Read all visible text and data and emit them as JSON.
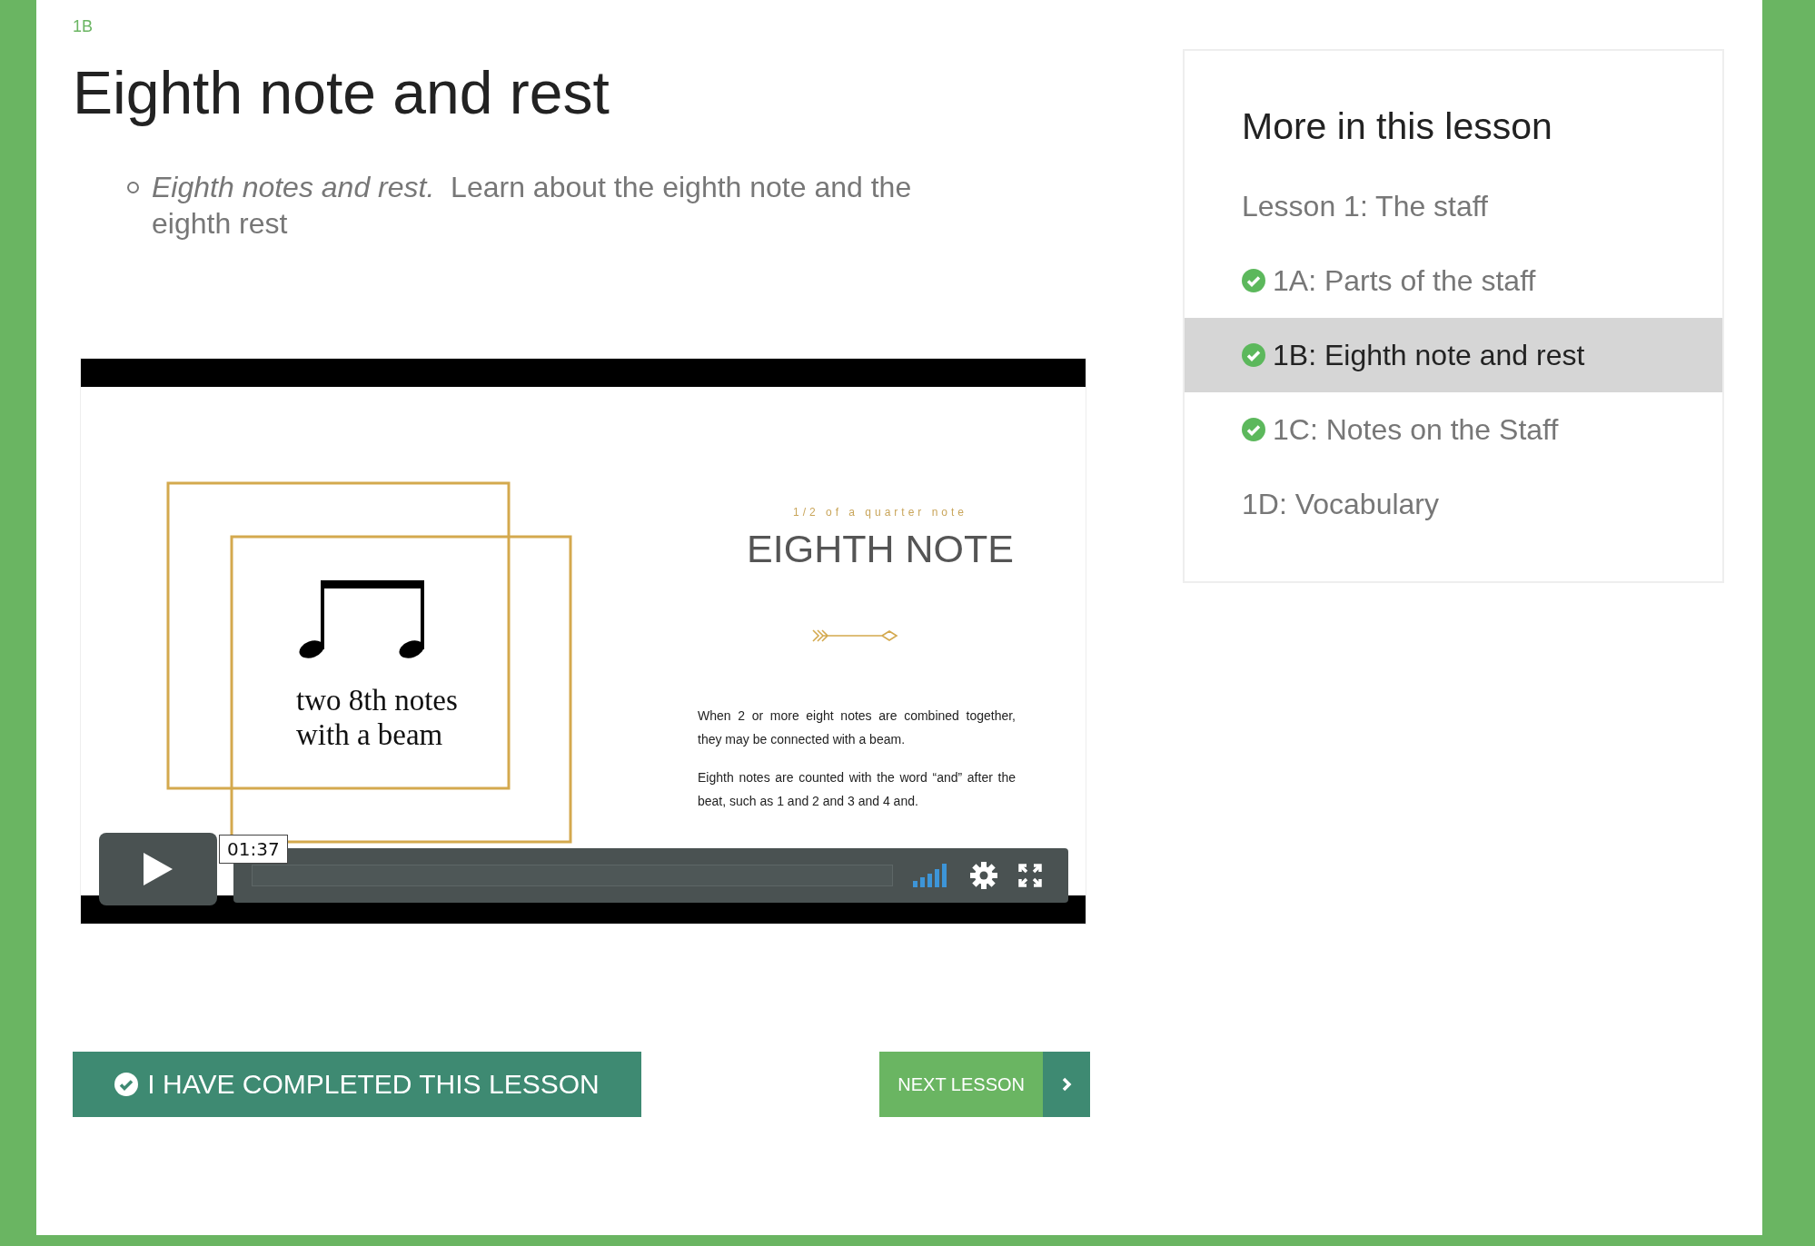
{
  "lesson_code": "1B",
  "title": "Eighth note and rest",
  "bullets": [
    "*Eighth notes and rest.*  Learn about the eighth note and the eighth rest"
  ],
  "video": {
    "slide": {
      "caption": [
        "two 8th notes",
        "with a beam"
      ],
      "subtitle": "1/2 of a quarter note",
      "heading": "EIGHTH NOTE",
      "paragraphs": [
        "When 2 or more eight notes are combined together, they may be connected with a beam.",
        "Eighth notes are counted with the word “and” after the beat, such as 1 and 2 and 3 and 4 and."
      ]
    },
    "time": "01:37"
  },
  "actions": [
    {
      "kind": "complete",
      "label": "I HAVE COMPLETED THIS LESSON"
    },
    {
      "kind": "next",
      "label": "NEXT LESSON"
    }
  ],
  "sidebar": {
    "title": "More in this lesson",
    "items": [
      {
        "label": "Lesson 1: The staff",
        "completed": false,
        "selected": false
      },
      {
        "label": "1A: Parts of the staff",
        "completed": true,
        "selected": false
      },
      {
        "label": "1B: Eighth note and rest",
        "completed": true,
        "selected": true
      },
      {
        "label": "1C: Notes on the Staff",
        "completed": true,
        "selected": false
      },
      {
        "label": "1D: Vocabulary",
        "completed": false,
        "selected": false
      }
    ]
  }
}
